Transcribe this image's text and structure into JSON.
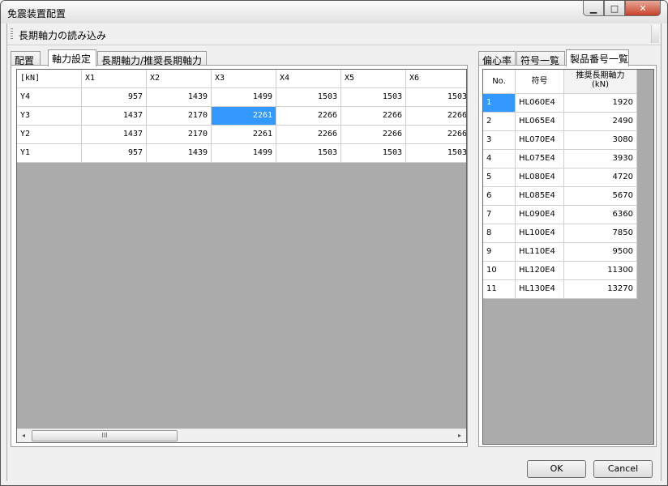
{
  "window": {
    "title": "免震装置配置",
    "minimize": "▁",
    "maximize": "□",
    "close": "✕"
  },
  "toolbar": {
    "load_label": "長期軸力の読み込み"
  },
  "left_tabs": [
    "配置",
    "軸力設定",
    "長期軸力/推奨長期軸力"
  ],
  "left_selected_tab": 1,
  "axial_table": {
    "corner": "[kN]",
    "columns": [
      "X1",
      "X2",
      "X3",
      "X4",
      "X5",
      "X6"
    ],
    "rows": [
      {
        "label": "Y4",
        "values": [
          "957",
          "1439",
          "1499",
          "1503",
          "1503",
          "1503"
        ]
      },
      {
        "label": "Y3",
        "values": [
          "1437",
          "2170",
          "2261",
          "2266",
          "2266",
          "2266"
        ]
      },
      {
        "label": "Y2",
        "values": [
          "1437",
          "2170",
          "2261",
          "2266",
          "2266",
          "2266"
        ]
      },
      {
        "label": "Y1",
        "values": [
          "957",
          "1439",
          "1499",
          "1503",
          "1503",
          "1503"
        ]
      }
    ],
    "selected": {
      "row": 1,
      "col": 2
    }
  },
  "scrollbar": {
    "left_arrow": "◂",
    "right_arrow": "▸",
    "thumb_grip": "III"
  },
  "right_tabs": [
    "偏心率",
    "符号一覧",
    "製品番号一覧"
  ],
  "right_selected_tab": 2,
  "product_table": {
    "headers": [
      "No.",
      "符号",
      "推奨長期軸力\n(kN)"
    ],
    "rows": [
      {
        "no": "1",
        "code": "HL060E4",
        "force": "1920"
      },
      {
        "no": "2",
        "code": "HL065E4",
        "force": "2490"
      },
      {
        "no": "3",
        "code": "HL070E4",
        "force": "3080"
      },
      {
        "no": "4",
        "code": "HL075E4",
        "force": "3930"
      },
      {
        "no": "5",
        "code": "HL080E4",
        "force": "4720"
      },
      {
        "no": "6",
        "code": "HL085E4",
        "force": "5670"
      },
      {
        "no": "7",
        "code": "HL090E4",
        "force": "6360"
      },
      {
        "no": "8",
        "code": "HL100E4",
        "force": "7850"
      },
      {
        "no": "9",
        "code": "HL110E4",
        "force": "9500"
      },
      {
        "no": "10",
        "code": "HL120E4",
        "force": "11300"
      },
      {
        "no": "11",
        "code": "HL130E4",
        "force": "13270"
      }
    ],
    "selected_row": 0
  },
  "buttons": {
    "ok": "OK",
    "cancel": "Cancel"
  },
  "colors": {
    "selection": "#3399ff",
    "grid_background": "#ababab"
  }
}
